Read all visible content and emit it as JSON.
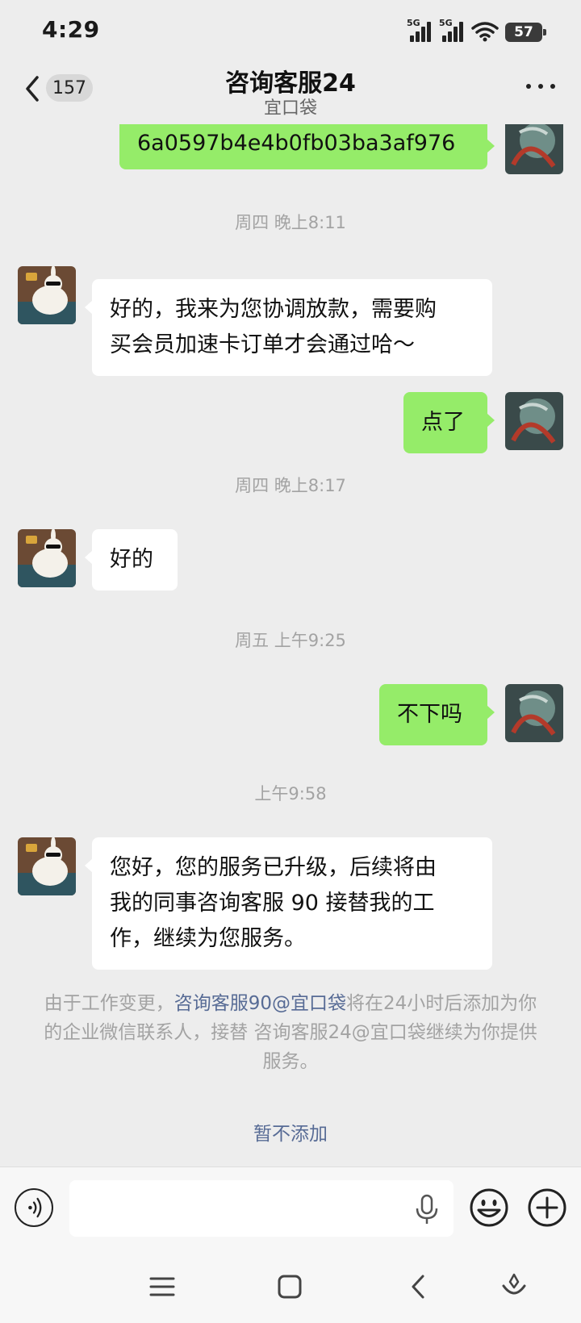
{
  "status": {
    "time": "4:29",
    "signal1_label": "5G",
    "signal2_label": "5G",
    "battery": "57",
    "icons": [
      "signal-5g-icon",
      "signal-5g-icon",
      "wifi-icon",
      "battery-icon"
    ]
  },
  "nav": {
    "back_icon": "chevron-left-icon",
    "unread_count": "157",
    "title": "咨询客服24",
    "subtitle": "宜口袋",
    "more_icon": "more-dots-icon"
  },
  "messages": [
    {
      "type": "out",
      "text": "6a0597b4e4b0fb03ba3af976"
    },
    {
      "type": "time",
      "text": "周四 晚上8:11"
    },
    {
      "type": "in",
      "text": "好的，我来为您协调放款，需要购\n买会员加速卡订单才会通过哈～"
    },
    {
      "type": "out",
      "text": "点了"
    },
    {
      "type": "time",
      "text": "周四 晚上8:17"
    },
    {
      "type": "in",
      "text": "好的"
    },
    {
      "type": "time",
      "text": "周五 上午9:25"
    },
    {
      "type": "out",
      "text": "不下吗"
    },
    {
      "type": "time",
      "text": "上午9:58"
    },
    {
      "type": "in",
      "text": "您好，您的服务已升级，后续将由\n我的同事咨询客服 90 接替我的工\n作，继续为您服务。"
    }
  ],
  "notice": {
    "prefix": "由于工作变更，",
    "link": "咨询客服90@宜口袋",
    "suffix": "将在24小时后添加为你的企业微信联系人，接替 咨询客服24@宜口袋继续为你提供服务。",
    "action": "暂不添加"
  },
  "input": {
    "value": "",
    "placeholder": "",
    "icons": [
      "voice-icon",
      "mic-icon",
      "emoji-icon",
      "plus-icon"
    ]
  },
  "system_nav": [
    "menu-icon",
    "home-icon",
    "back-icon",
    "assistant-icon"
  ],
  "colors": {
    "background": "#ededed",
    "outgoing_bubble": "#95ec69",
    "incoming_bubble": "#ffffff",
    "link": "#576b95",
    "timestamp": "#a3a3a3"
  }
}
